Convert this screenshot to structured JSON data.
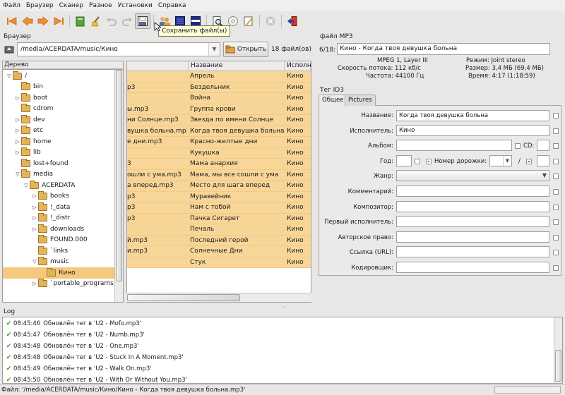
{
  "menu": [
    "Файл",
    "Браузер",
    "Сканер",
    "Разное",
    "Установки",
    "Справка"
  ],
  "tooltip": "Сохранить файл(ы)",
  "browser": {
    "label": "Браузер",
    "path": "/media/ACERDATA/music/Кино",
    "open_button": "Открыть",
    "file_count": "18 файл(ов)",
    "tree_header": "Дерево",
    "tree": [
      {
        "label": "/",
        "depth": 0,
        "arrow": "▽"
      },
      {
        "label": "bin",
        "depth": 1,
        "arrow": ""
      },
      {
        "label": "boot",
        "depth": 1,
        "arrow": "▷"
      },
      {
        "label": "cdrom",
        "depth": 1,
        "arrow": ""
      },
      {
        "label": "dev",
        "depth": 1,
        "arrow": "▷"
      },
      {
        "label": "etc",
        "depth": 1,
        "arrow": "▷"
      },
      {
        "label": "home",
        "depth": 1,
        "arrow": "▷"
      },
      {
        "label": "lib",
        "depth": 1,
        "arrow": "▷"
      },
      {
        "label": "lost+found",
        "depth": 1,
        "arrow": ""
      },
      {
        "label": "media",
        "depth": 1,
        "arrow": "▽"
      },
      {
        "label": "ACERDATA",
        "depth": 2,
        "arrow": "▽"
      },
      {
        "label": "books",
        "depth": 3,
        "arrow": "▷"
      },
      {
        "label": "!_data",
        "depth": 3,
        "arrow": "▷"
      },
      {
        "label": "!_distr",
        "depth": 3,
        "arrow": "▷"
      },
      {
        "label": "downloads",
        "depth": 3,
        "arrow": "▷"
      },
      {
        "label": "FOUND.000",
        "depth": 3,
        "arrow": ""
      },
      {
        "label": "`links",
        "depth": 3,
        "arrow": ""
      },
      {
        "label": "music",
        "depth": 3,
        "arrow": "▽"
      },
      {
        "label": "Кино",
        "depth": 4,
        "arrow": "",
        "selected": true
      },
      {
        "label": "`portable_programs",
        "depth": 3,
        "arrow": "▷"
      }
    ],
    "columns": [
      "Название",
      "Исполни"
    ],
    "files": [
      {
        "file": "",
        "title": "Апрель",
        "artist": "Кино"
      },
      {
        "file": "p3",
        "title": "Бездельник",
        "artist": "Кино"
      },
      {
        "file": "",
        "title": "Война",
        "artist": "Кино"
      },
      {
        "file": "ы.mp3",
        "title": "Группа  крови",
        "artist": "Кино"
      },
      {
        "file": "ни Солнце.mp3",
        "title": "Звезда по имени Солнце",
        "artist": "Кино"
      },
      {
        "file": "вушка больна.mp3",
        "title": "Когда твоя девушка больна",
        "artist": "Кино"
      },
      {
        "file": "е дни.mp3",
        "title": "Красно-желтые дни",
        "artist": "Кино"
      },
      {
        "file": "",
        "title": "Кукушка",
        "artist": "Кино"
      },
      {
        "file": "3",
        "title": "Мама анархия",
        "artist": "Кино"
      },
      {
        "file": "ошли с ума.mp3",
        "title": "Мама, мы все сошли с ума",
        "artist": "Кино"
      },
      {
        "file": "а вперед.mp3",
        "title": "Место для шага вперед",
        "artist": "Кино"
      },
      {
        "file": "p3",
        "title": "Муравейник",
        "artist": "Кино"
      },
      {
        "file": "p3",
        "title": "Нам с тобой",
        "artist": "Кино"
      },
      {
        "file": "p3",
        "title": "Пачка Сигарет",
        "artist": "Кино"
      },
      {
        "file": "",
        "title": "Печаль",
        "artist": "Кино"
      },
      {
        "file": "й.mp3",
        "title": "Последний герой",
        "artist": "Кино"
      },
      {
        "file": "и.mp3",
        "title": "Солнечные Дни",
        "artist": "Кино"
      },
      {
        "file": "",
        "title": "Стук",
        "artist": "Кино"
      }
    ]
  },
  "mp3": {
    "label": "файл MP3",
    "position": "6/18:",
    "filename": "Кино - Когда твоя девушка больна",
    "codec": "MPEG 1, Layer III",
    "bitrate": "Скорость потока: 112 кб/с",
    "frequency": "Частота: 44100 Гц",
    "mode": "Режим: Joint stereo",
    "size": "Размер: 3,4 МБ (69,4 МБ)",
    "time": "Время: 4:17 (1:18:59)"
  },
  "id3": {
    "label": "Тег ID3",
    "tabs": [
      "Общее",
      "Pictures"
    ],
    "fields": {
      "title_label": "Название:",
      "title": "Когда твоя девушка больна",
      "artist_label": "Исполнитель:",
      "artist": "Кино",
      "album_label": "Альбом:",
      "album": "",
      "cd_label": "CD:",
      "year_label": "Год:",
      "track_label": "Номер дорожки:",
      "track_sep": "/",
      "genre_label": "Жанр:",
      "comment_label": "Комментарий:",
      "composer_label": "Композитор:",
      "orig_artist_label": "Первый исполнитель:",
      "copyright_label": "Авторское право:",
      "url_label": "Ссылка (URL):",
      "encoder_label": "Кодировщик:"
    }
  },
  "log": {
    "label": "Log",
    "entries": [
      {
        "time": "08:45:46",
        "text": "Обновлён тег в 'U2 - Mofo.mp3'"
      },
      {
        "time": "08:45:47",
        "text": "Обновлён тег в 'U2 - Numb.mp3'"
      },
      {
        "time": "08:45:48",
        "text": "Обновлён тег в 'U2 - One.mp3'"
      },
      {
        "time": "08:45:48",
        "text": "Обновлён тег в 'U2 - Stuck In A Moment.mp3'"
      },
      {
        "time": "08:45:49",
        "text": "Обновлён тег в 'U2 - Walk On.mp3'"
      },
      {
        "time": "08:45:50",
        "text": "Обновлён тег в 'U2 - With Or Without You.mp3'"
      }
    ]
  },
  "status": "Файл: '/media/ACERDATA/music/Кино/Кино - Когда твоя девушка больна.mp3'",
  "colors": {
    "selection": "#f5c97c",
    "row": "#f8d698",
    "check": "#4a9a2a"
  }
}
